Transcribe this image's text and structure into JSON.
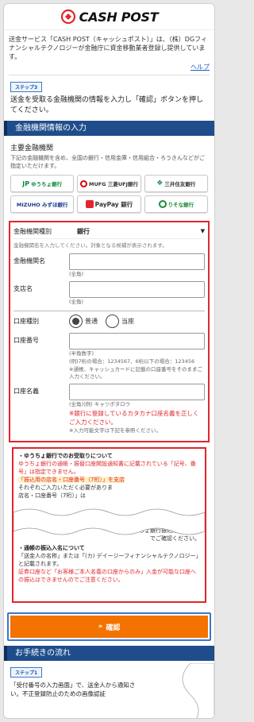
{
  "header": {
    "logo_text": "CASH POST",
    "brand_color": "#e0262c"
  },
  "intro": {
    "text": "送金サービス「CASH POST（キャッシュポスト）」は、（株）DGフィナンシャルテクノロジーが金融庁に資金移動業者登録し提供しています。",
    "help_link": "ヘルプ"
  },
  "step3": {
    "badge": "ステップ3",
    "text": "送金を受取る金融機関の情報を入力し「確認」ボタンを押してください。"
  },
  "bank_section": {
    "title": "金融機関情報の入力",
    "main_title": "主要金融機関",
    "main_desc": "下記の金融機関を含め、全国の銀行・信用金庫・信用組合・ろうきんなどがご指定いただけます。",
    "banks": [
      {
        "name": "ゆうちょ銀行",
        "icon": "JP",
        "color": "#0a8a3d"
      },
      {
        "name": "MUFG 三菱UFJ銀行",
        "icon": "MUFG",
        "color": "#d7000f"
      },
      {
        "name": "三井住友銀行",
        "icon": "SMBC",
        "color": "#0b8f4e"
      },
      {
        "name": "MIZUHO みずほ銀行",
        "icon": "MIZUHO",
        "color": "#1d3a8f"
      },
      {
        "name": "PayPay 銀行",
        "icon": "PayPay",
        "color": "#e0262c"
      },
      {
        "name": "りそな銀行",
        "icon": "R",
        "color": "#1e8c3a"
      }
    ]
  },
  "form": {
    "type_label": "金融機関種別",
    "type_value": "銀行",
    "hint": "金融機関名を入力してください。対象となる候補が表示されます。",
    "bank_name_label": "金融機関名",
    "bank_name_note": "(全角)",
    "branch_label": "支店名",
    "branch_note": "(全角)",
    "account_type_label": "口座種別",
    "account_type_options": [
      "普通",
      "当座"
    ],
    "account_no_label": "口座番号",
    "account_no_notes": [
      "(半角数字)",
      "(例)7桁の場合：1234567、6桁以下の場合：123456",
      "※通帳、キャッシュカードに記載の口座番号をそのままご入力ください。"
    ],
    "holder_label": "口座名義",
    "holder_example": "(全角)(例) キャツポタロウ",
    "holder_warn": "※銀行に登録しているカタカナ口座名義を正しくご入力ください。",
    "holder_note": "※入力可能文字は下記を参照ください。"
  },
  "notice": {
    "p1_title": "・ゆうちょ銀行でのお受取りについて",
    "p1_red": "ゆうちょ銀行の通帳・振替口座開設通知書に記載されている「記号、番号」は指定できません。",
    "p1_hl": "「振込用の店名・口座番号（7桁）」を支店",
    "p1_rest": "それぞれご入力いただく必要がありま",
    "p1_rest2": "店名・口座番号（7桁）」は",
    "p2_tail": "ゆうちょ銀行振込用口座番号",
    "p2_tail2": "でご確認ください。",
    "p3_title": "・通帳の振込入名について",
    "p3_text": "「送金人の名称」または「(カ) デイージーフィナンシャルテクノロジー」と記載されます。",
    "p3_red": "証券口座など「お客様ご本人名義の口座からのみ」入金が可能な口座への振込はできませんのでご注意ください。"
  },
  "confirm": {
    "label": "確認",
    "color": "#f47200"
  },
  "procedure": {
    "title": "お手続きの流れ",
    "badge": "ステップ1",
    "text": "「受付番号の入力画面」で、送金人から通知さ",
    "text2": "い。不正登録防止のための画像認証"
  }
}
